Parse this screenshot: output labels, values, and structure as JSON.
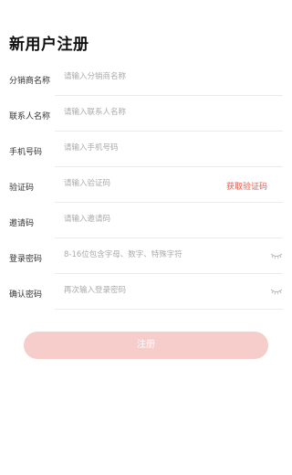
{
  "page": {
    "title": "新用户注册"
  },
  "form": {
    "fields": [
      {
        "label": "分销商名称",
        "placeholder": "请输入分销商名称",
        "value": ""
      },
      {
        "label": "联系人名称",
        "placeholder": "请输入联系人名称",
        "value": ""
      },
      {
        "label": "手机号码",
        "placeholder": "请输入手机号码",
        "value": ""
      },
      {
        "label": "验证码",
        "placeholder": "请输入验证码",
        "value": ""
      },
      {
        "label": "邀请码",
        "placeholder": "请输入邀请码",
        "value": ""
      },
      {
        "label": "登录密码",
        "placeholder": "8-16位包含字母、数字、特殊字符",
        "value": ""
      },
      {
        "label": "确认密码",
        "placeholder": "再次输入登录密码",
        "value": ""
      }
    ],
    "get_code_label": "获取验证码",
    "submit_label": "注册"
  },
  "icons": {
    "password_toggle": "eye-closed-icon"
  },
  "colors": {
    "accent": "#e85a4f",
    "button_disabled": "#f6cdcb"
  }
}
